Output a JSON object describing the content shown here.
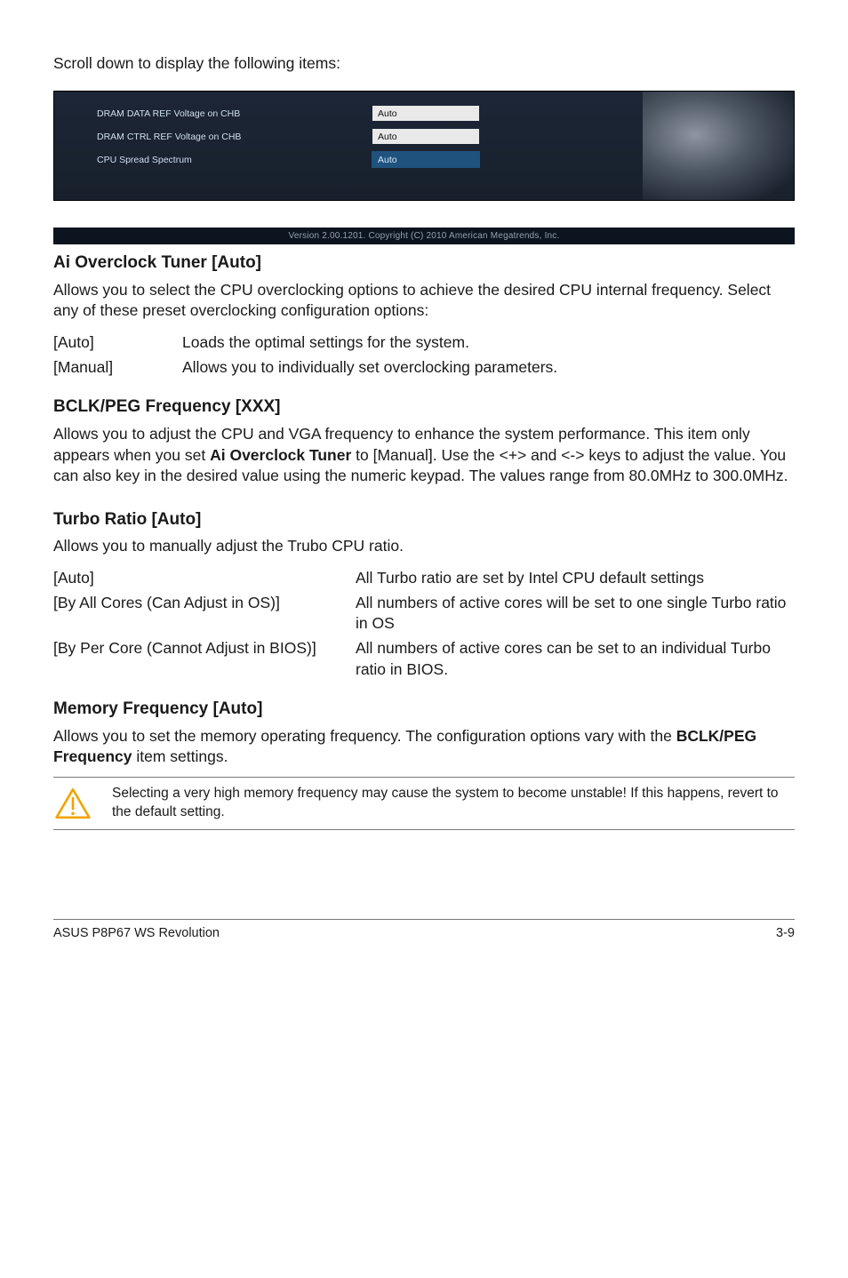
{
  "intro": "Scroll down to display the following items:",
  "bios": {
    "rows": [
      {
        "label": "DRAM DATA REF Voltage on CHB",
        "value": "Auto",
        "selected": false
      },
      {
        "label": "DRAM CTRL REF Voltage on CHB",
        "value": "Auto",
        "selected": false
      },
      {
        "label": "CPU Spread Spectrum",
        "value": "Auto",
        "selected": true
      }
    ],
    "footer": "Version 2.00.1201.  Copyright (C) 2010 American Megatrends, Inc."
  },
  "sections": {
    "ai": {
      "title": "Ai Overclock Tuner [Auto]",
      "desc": "Allows you to select the CPU overclocking options to achieve the desired CPU internal frequency. Select any of these preset overclocking configuration options:",
      "rows": [
        {
          "k": "[Auto]",
          "v": "Loads the optimal settings for the system."
        },
        {
          "k": "[Manual]",
          "v": "Allows you to individually set overclocking parameters."
        }
      ]
    },
    "bclk": {
      "title": "BCLK/PEG Frequency [XXX]",
      "desc_pre": "Allows you to adjust the CPU and VGA frequency to enhance the system performance. This item only appears when you set ",
      "desc_bold": "Ai Overclock Tuner",
      "desc_post": " to [Manual]. Use the <+> and <-> keys to adjust the value. You can also key in the desired value using the numeric keypad. The values range from 80.0MHz to 300.0MHz."
    },
    "turbo": {
      "title": "Turbo Ratio [Auto]",
      "desc": "Allows you to manually adjust the Trubo CPU ratio.",
      "rows": [
        {
          "k": "[Auto]",
          "v": "All Turbo ratio are set by Intel CPU default settings"
        },
        {
          "k": "[By All Cores (Can Adjust in OS)]",
          "v": "All numbers of active cores will be set to one single Turbo ratio in OS"
        },
        {
          "k": "[By Per Core (Cannot Adjust in BIOS)]",
          "v": "All numbers of active cores can be set to an individual Turbo ratio in BIOS."
        }
      ]
    },
    "mem": {
      "title": "Memory Frequency [Auto]",
      "desc_pre": "Allows you to set the memory operating frequency. The configuration options vary with the ",
      "desc_bold": "BCLK/PEG Frequency",
      "desc_post": " item settings."
    }
  },
  "callout": "Selecting a very high memory frequency may cause the system to become unstable! If this happens, revert to the default setting.",
  "footer": {
    "left": "ASUS P8P67 WS Revolution",
    "right": "3-9"
  }
}
